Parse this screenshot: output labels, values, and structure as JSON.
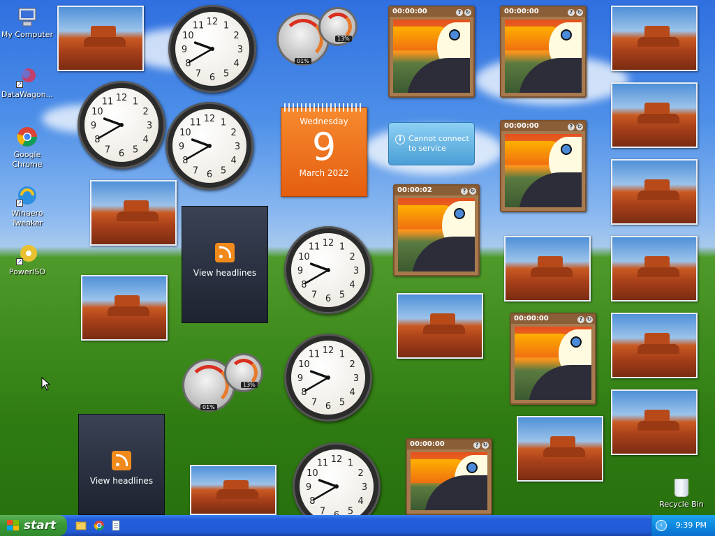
{
  "desktop_icons": [
    {
      "label": "My Computer",
      "icon": "computer-icon"
    },
    {
      "label": "DataWagon...",
      "icon": "datawagon-icon"
    },
    {
      "label": "Google Chrome",
      "icon": "chrome-icon"
    },
    {
      "label": "Winaero Tweaker",
      "icon": "winaero-icon"
    },
    {
      "label": "PowerISO",
      "icon": "poweriso-icon"
    }
  ],
  "clock_time": {
    "hour": 9,
    "minute": 40
  },
  "calendar": {
    "weekday": "Wednesday",
    "day": "9",
    "month_year": "March 2022"
  },
  "weather": {
    "message": "Cannot connect to service"
  },
  "toucan_timers": [
    "00:00:00",
    "00:00:00",
    "00:00:00",
    "00:00:02",
    "00:00:00",
    "00:00:00"
  ],
  "rss": {
    "label": "View headlines"
  },
  "cpu_meters": [
    {
      "cpu": "01%",
      "memory": "13%"
    },
    {
      "cpu": "01%",
      "memory": "13%"
    }
  ],
  "recycle_bin": {
    "label": "Recycle Bin"
  },
  "taskbar": {
    "start_label": "start",
    "clock": "9:39 PM"
  },
  "colors": {
    "taskbar": "#245edb",
    "start": "#3c9a38",
    "calendar": "#e45e10"
  }
}
